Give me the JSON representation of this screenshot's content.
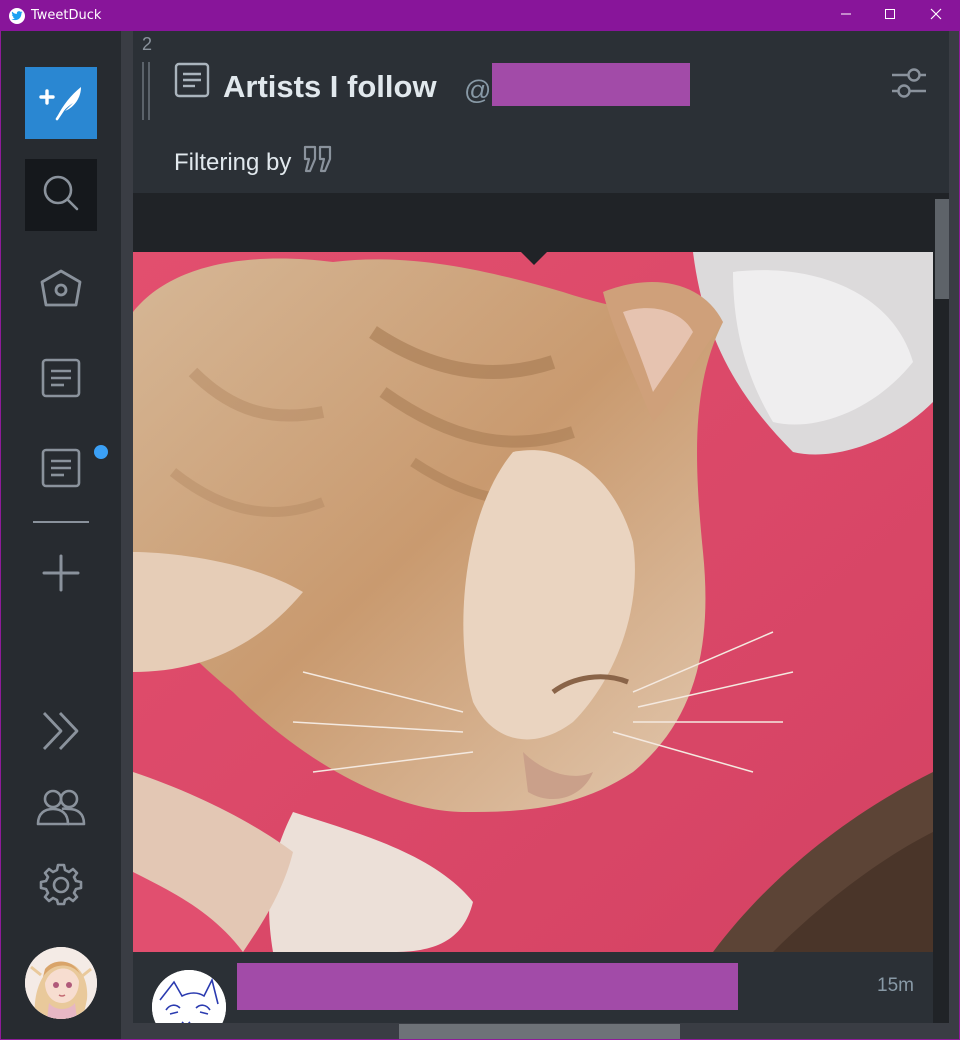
{
  "window": {
    "title": "TweetDuck",
    "app_icon": "twitter-bird-icon",
    "controls": [
      "minimize-icon",
      "maximize-icon",
      "close-icon"
    ],
    "accent": "#88159a"
  },
  "sidebar": {
    "buttons": [
      {
        "name": "compose",
        "icon": "compose-tweet-icon",
        "color": "#2a87d2"
      },
      {
        "name": "search",
        "icon": "search-icon"
      },
      {
        "name": "home",
        "icon": "home-icon"
      },
      {
        "name": "list-1",
        "icon": "list-icon"
      },
      {
        "name": "list-2",
        "icon": "list-icon",
        "has_unread": true
      },
      {
        "name": "add-column",
        "icon": "plus-icon"
      },
      {
        "name": "expand",
        "icon": "double-chevron-right-icon"
      },
      {
        "name": "accounts",
        "icon": "accounts-icon"
      },
      {
        "name": "settings",
        "icon": "gear-icon"
      }
    ],
    "unread_dot_color": "#3ba0f5"
  },
  "column": {
    "number": "2",
    "title": "Artists I follow",
    "at_sign": "@",
    "filter_label": "Filtering by",
    "filter_icon": "quote-icon",
    "options_icon": "sliders-icon"
  },
  "tweet": {
    "media_icon": "photo-cat",
    "time": "15m"
  }
}
